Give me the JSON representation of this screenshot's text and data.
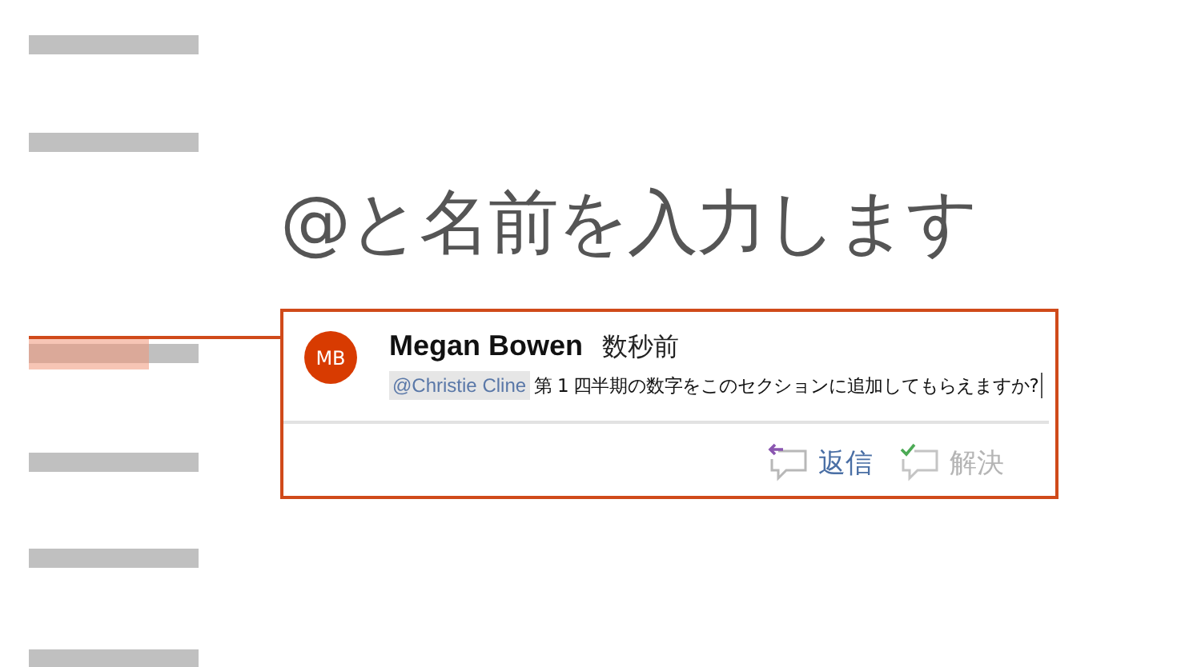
{
  "outline_lines": [
    {
      "highlighted": false
    },
    {
      "highlighted": false
    },
    {
      "highlighted": true
    },
    {
      "highlighted": false
    },
    {
      "highlighted": false
    },
    {
      "highlighted": false
    }
  ],
  "heading": "@と名前を入力します",
  "comment": {
    "avatar_initials": "MB",
    "author": "Megan Bowen",
    "time": "数秒前",
    "mention": "@Christie Cline",
    "message": "第 1 四半期の数字をこのセクションに追加してもらえますか?",
    "actions": [
      {
        "kind": "reply",
        "label": "返信",
        "disabled": false
      },
      {
        "kind": "resolve",
        "label": "解決",
        "disabled": true
      }
    ]
  }
}
